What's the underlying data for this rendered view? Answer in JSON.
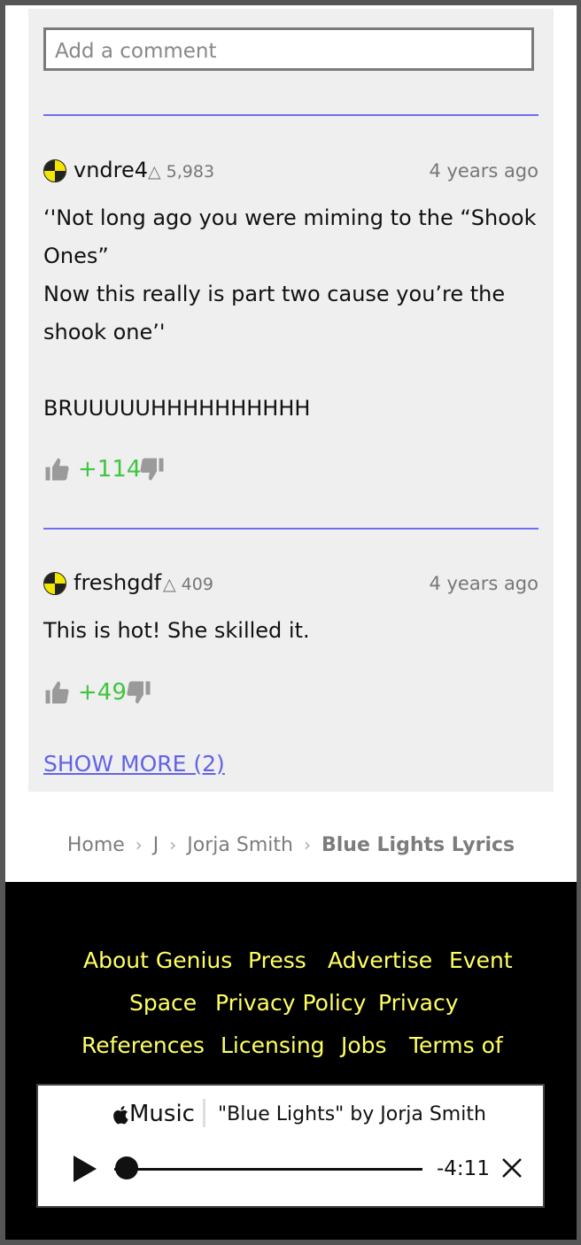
{
  "comment_box": {
    "placeholder": "Add a comment"
  },
  "comments": [
    {
      "username": "vndre4",
      "iq": "△ 5,983",
      "time": "4 years ago",
      "body": "‘'Not long ago you were miming to the “Shook Ones”\nNow this really is part two cause you’re the shook one’'\n\nBRUUUUUHHHHHHHHHH",
      "score": "+114"
    },
    {
      "username": "freshgdf",
      "iq": "△ 409",
      "time": "4 years ago",
      "body": "This is hot! She skilled it.",
      "score": "+49"
    }
  ],
  "show_more": "SHOW MORE (2)",
  "breadcrumb": {
    "home": "Home",
    "letter": "J",
    "artist": "Jorja Smith",
    "current": "Blue Lights Lyrics",
    "separator": "›"
  },
  "footer_links": [
    "About Genius",
    "Press",
    "Advertise",
    "Event",
    "Space",
    "Privacy Policy",
    "Privacy",
    "References",
    "Licensing",
    "Jobs",
    "Terms of"
  ],
  "player": {
    "service": "Music",
    "track": "\"Blue Lights\" by Jorja Smith",
    "remaining": "-4:11"
  },
  "colors": {
    "accent_blue": "#6f6ff0",
    "score_green": "#3fc63f",
    "footer_link": "#ffff64"
  },
  "icons": [
    "user-avatar-icon",
    "thumbs-up-icon",
    "thumbs-down-icon",
    "apple-logo-icon",
    "play-icon",
    "close-icon"
  ]
}
